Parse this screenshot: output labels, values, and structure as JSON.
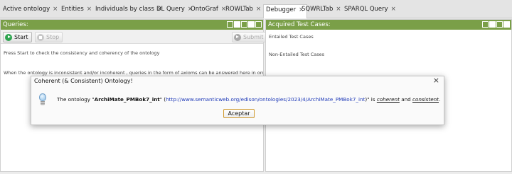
{
  "tabs": [
    {
      "label": "Active ontology",
      "close": "×"
    },
    {
      "label": "Entities",
      "close": "×"
    },
    {
      "label": "Individuals by class",
      "close": "×"
    },
    {
      "label": "DL Query",
      "close": "×"
    },
    {
      "label": "OntoGraf",
      "close": "×"
    },
    {
      "label": "ROWLTab",
      "close": "×"
    },
    {
      "label": "Debugger",
      "close": "×"
    },
    {
      "label": "SQWRLTab",
      "close": "×"
    },
    {
      "label": "SPARQL Query",
      "close": "×"
    }
  ],
  "active_tab": "Debugger",
  "queries": {
    "title": "Queries:",
    "start_label": "Start",
    "stop_label": "Stop",
    "submit_label": "Submit",
    "info1": "Press Start to check the consistency and coherency of the ontology",
    "info2": "When the ontology is inconsistent and/or incoherent , queries in the form of axioms can be answered here in order to"
  },
  "acquired": {
    "title": "Acquired Test Cases:",
    "entailed": "Entailed Test Cases",
    "non_entailed": "Non-Entailed Test Cases"
  },
  "dialog": {
    "title": "Coherent (& Consistent) Ontology!",
    "close": "×",
    "pre": "The ontology \"",
    "ontology_name": "ArchiMate_PMBok7_int",
    "mid": "\" (",
    "url": "http://www.semanticweb.org/edison/ontologies/2023/4/ArchiMate_PMBok7_int",
    "post": ")\" is ",
    "coherent": "coherent",
    "and": " and ",
    "consistent": "consistent",
    "end": ".",
    "button": "Aceptar"
  },
  "colors": {
    "header_green": "#7a9f48",
    "link_blue": "#1f3ab8"
  }
}
